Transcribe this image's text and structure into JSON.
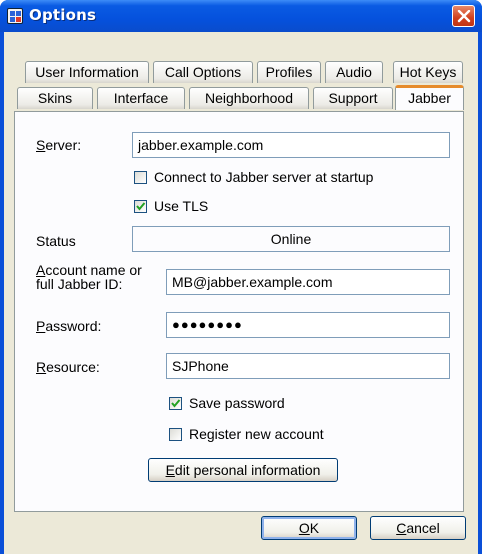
{
  "window": {
    "title": "Options"
  },
  "tabs_row1": [
    "User Information",
    "Call Options",
    "Profiles",
    "Audio",
    "Hot Keys"
  ],
  "tabs_row2": [
    "Skins",
    "Interface",
    "Neighborhood",
    "Support",
    "Jabber"
  ],
  "active_tab": "Jabber",
  "form": {
    "server_label_u": "S",
    "server_label_rest": "erver:",
    "server_value": "jabber.example.com",
    "connect_startup_label": "Connect to Jabber server at startup",
    "connect_startup_checked": false,
    "use_tls_label": "Use TLS",
    "use_tls_checked": true,
    "status_label": "Status",
    "status_value": "Online",
    "account_label_u": "A",
    "account_label_rest1": "ccount name or",
    "account_label_line2": "full Jabber ID:",
    "account_value": "MB@jabber.example.com",
    "password_label_u": "P",
    "password_label_rest": "assword:",
    "password_value": "●●●●●●●●",
    "resource_label_u": "R",
    "resource_label_rest": "esource:",
    "resource_value": "SJPhone",
    "save_password_label": "Save password",
    "save_password_checked": true,
    "register_label": "Register new account",
    "register_checked": false,
    "edit_info_u": "E",
    "edit_info_rest": "dit personal information"
  },
  "buttons": {
    "ok_u": "O",
    "ok_rest": "K",
    "cancel_u": "C",
    "cancel_rest": "ancel"
  },
  "colors": {
    "title_bar": "#0a5be3",
    "dialog_face": "#ece9d8",
    "active_tab_accent": "#e68b2c",
    "close_button": "#d1401e"
  }
}
